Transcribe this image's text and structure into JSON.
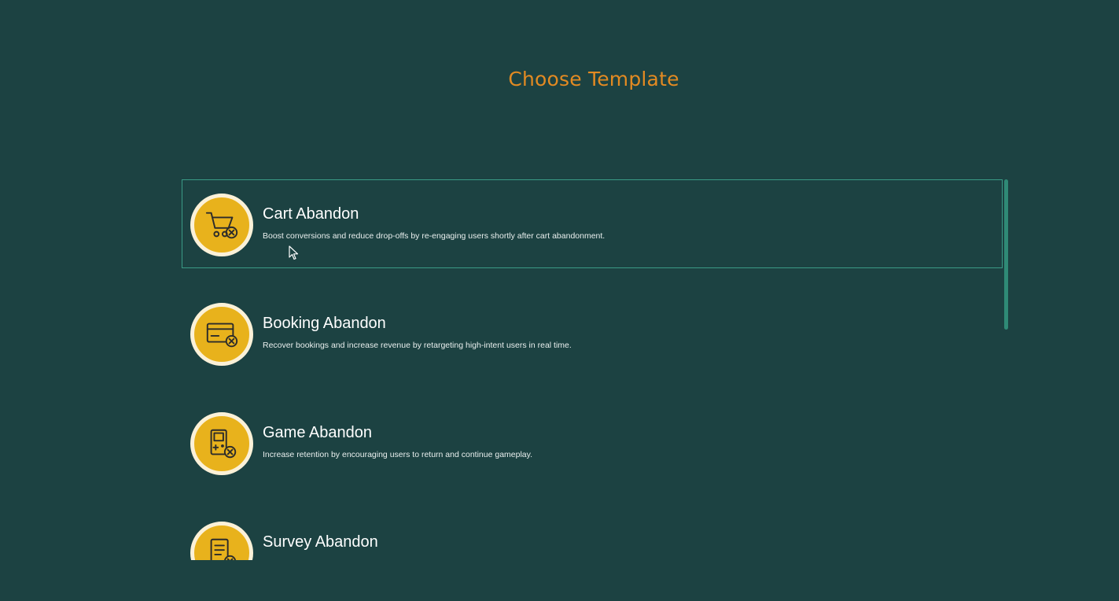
{
  "page": {
    "title": "Choose Template"
  },
  "templates": [
    {
      "title": "Cart Abandon",
      "description": "Boost conversions and reduce drop-offs by re-engaging users shortly after cart abandonment.",
      "icon": "cart-cancel-icon",
      "selected": true
    },
    {
      "title": "Booking Abandon",
      "description": "Recover bookings and increase revenue by retargeting high-intent users in real time.",
      "icon": "booking-cancel-icon",
      "selected": false
    },
    {
      "title": "Game Abandon",
      "description": "Increase retention by encouraging users to return and continue gameplay.",
      "icon": "game-cancel-icon",
      "selected": false
    },
    {
      "title": "Survey Abandon",
      "description": "",
      "icon": "survey-cancel-icon",
      "selected": false
    }
  ],
  "colors": {
    "background": "#1c4242",
    "title": "#e28a22",
    "icon_fill": "#e8b21c",
    "icon_ring": "#fbf1d8",
    "selected_border": "#3a9a86",
    "scrollbar": "#2f8a76"
  }
}
